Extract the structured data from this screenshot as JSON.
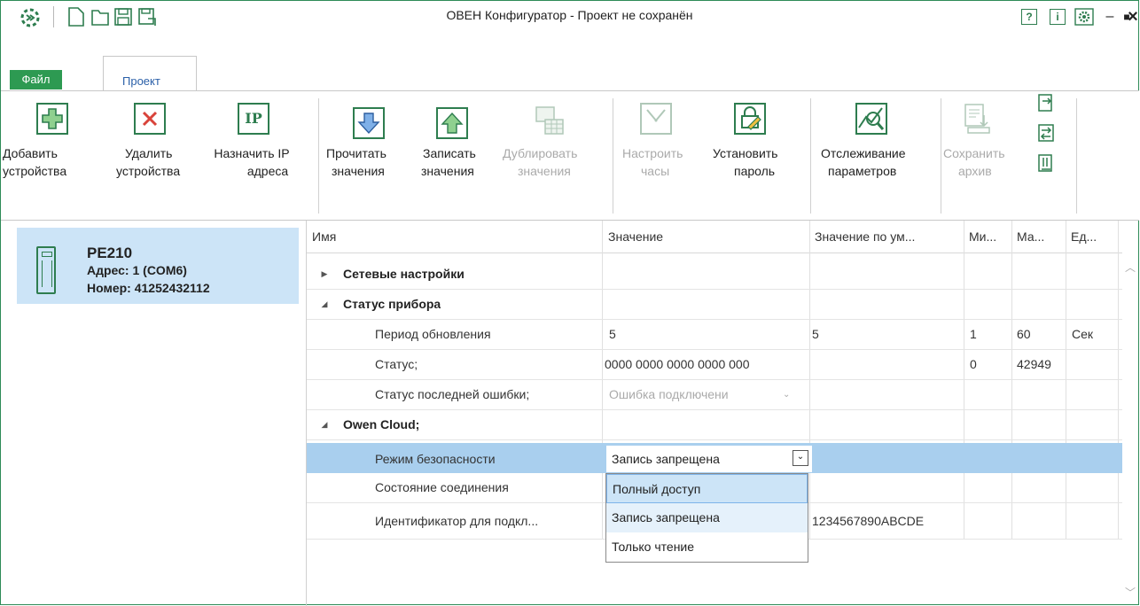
{
  "window": {
    "title": "ОВЕН Конфигуратор - Проект не сохранён"
  },
  "title_buttons": {
    "help": "?",
    "info": "i"
  },
  "window_controls": {
    "minimize": "–",
    "maximize": "■",
    "close": "×"
  },
  "tabs": {
    "file": "Файл",
    "project": "Проект"
  },
  "ribbon": {
    "add_devices": [
      "Добавить",
      "устройства"
    ],
    "delete_devices": [
      "Удалить",
      "устройства"
    ],
    "assign_ip": [
      "Назначить IP",
      "адреса"
    ],
    "ip_icon_text": "IP",
    "read_values": [
      "Прочитать",
      "значения"
    ],
    "write_values": [
      "Записать",
      "значения"
    ],
    "duplicate_values": [
      "Дублировать",
      "значения"
    ],
    "set_clock": [
      "Настроить",
      "часы"
    ],
    "set_password": [
      "Установить",
      "пароль"
    ],
    "monitor_params": [
      "Отслеживание",
      "параметров"
    ],
    "save_archive": [
      "Сохранить",
      "архив"
    ]
  },
  "device": {
    "name": "PE210",
    "address": "Адрес: 1 (COM6)",
    "number": "Номер: 41252432112"
  },
  "grid": {
    "columns": [
      "Имя",
      "Значение",
      "Значение по ум...",
      "Ми...",
      "Ма...",
      "Ед..."
    ],
    "rows": [
      {
        "name": "Сетевые настройки",
        "value": "",
        "default": "",
        "min": "",
        "max": "",
        "unit": ""
      },
      {
        "name": "Статус прибора",
        "value": "",
        "default": "",
        "min": "",
        "max": "",
        "unit": ""
      },
      {
        "name": "Период обновления",
        "value": "5",
        "default": "5",
        "min": "1",
        "max": "60",
        "unit": "Сек"
      },
      {
        "name": "Статус;",
        "value": "0000 0000 0000 0000 000",
        "default": "",
        "min": "0",
        "max": "42949",
        "unit": ""
      },
      {
        "name": "Статус последней ошибки;",
        "value": "Ошибка подключени",
        "default": "",
        "min": "",
        "max": "",
        "unit": ""
      },
      {
        "name": "Owen Cloud;",
        "value": "",
        "default": "",
        "min": "",
        "max": "",
        "unit": ""
      },
      {
        "name": "Режим безопасности",
        "value": "Запись запрещена",
        "default": "",
        "min": "",
        "max": "",
        "unit": ""
      },
      {
        "name": "Состояние соединения",
        "value": "",
        "default": "",
        "min": "",
        "max": "",
        "unit": ""
      },
      {
        "name": "Идентификатор для подкл...",
        "value": "",
        "default": "1234567890ABCDE",
        "min": "",
        "max": "",
        "unit": ""
      }
    ]
  },
  "security_dropdown": {
    "selected": "Запись запрещена",
    "options": [
      "Полный доступ",
      "Запись запрещена",
      "Только чтение"
    ]
  },
  "colors": {
    "accent": "#2d9a52",
    "selection": "#a9cfee",
    "device_card": "#cce4f7"
  }
}
